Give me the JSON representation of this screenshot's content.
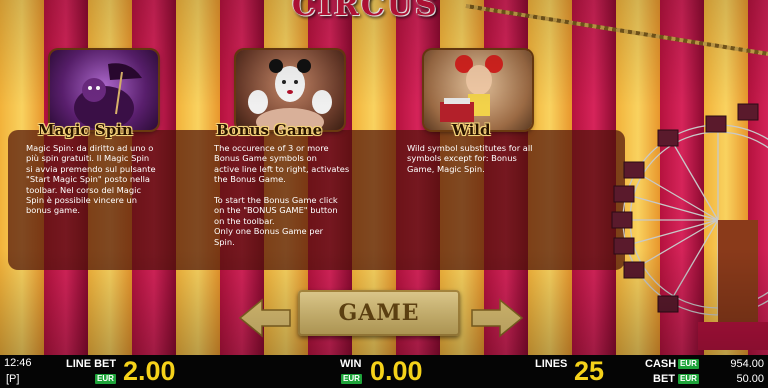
{
  "game": {
    "title": "CIRCUS"
  },
  "symbols": [
    {
      "name": "Magic Spin",
      "label": "Magic Spin",
      "description": "Magic Spin: da diritto ad uno o\npiù spin gratuiti. Il Magic Spin\nsi avvia premendo sul pulsante\n\"Start Magic Spin\" posto nella\ntoolbar. Nel corso del Magic\nSpin è possibile vincere un\nbonus game."
    },
    {
      "name": "Bonus Game",
      "label": "Bonus Game",
      "description": "The occurence of 3 or more\nBonus Game symbols on\nactive line left to right, activates\nthe Bonus Game.\n\nTo start the Bonus Game click\non the \"BONUS GAME\" button\non the toolbar.\nOnly one Bonus Game per\nSpin."
    },
    {
      "name": "Wild",
      "label": "Wild",
      "description": "Wild symbol substitutes for all\nsymbols except for: Bonus\nGame, Magic Spin."
    }
  ],
  "navigation": {
    "game_button": "GAME",
    "prev_icon": "arrow-left-icon",
    "next_icon": "arrow-right-icon"
  },
  "status_bar": {
    "time": "12:46",
    "key_hint": "[P]",
    "line_bet_label": "LINE BET",
    "line_bet_currency": "EUR",
    "line_bet_value": "2.00",
    "win_label": "WIN",
    "win_currency": "EUR",
    "win_value": "0.00",
    "lines_label": "LINES",
    "lines_value": "25",
    "cash_label": "CASH",
    "cash_currency": "EUR",
    "cash_value": "954.00",
    "bet_label": "BET",
    "bet_currency": "EUR",
    "bet_value": "50.00"
  },
  "colors": {
    "accent_yellow": "#f5d21a",
    "currency_green": "#1ea43a",
    "curtain_red": "#c8143c",
    "curtain_gold": "#f2b23a"
  }
}
